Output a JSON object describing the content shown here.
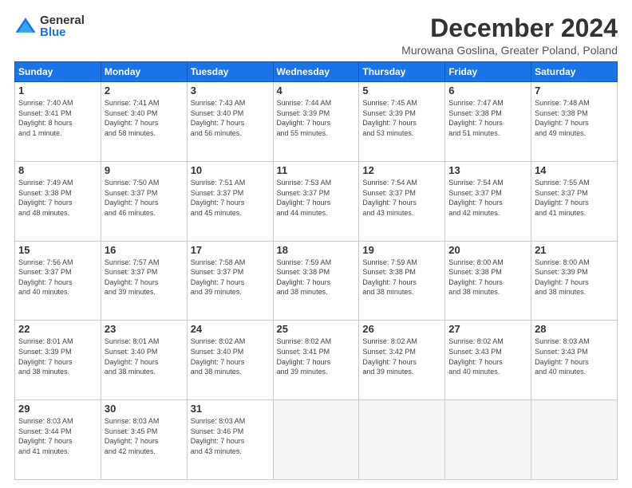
{
  "header": {
    "logo_general": "General",
    "logo_blue": "Blue",
    "month_title": "December 2024",
    "location": "Murowana Goslina, Greater Poland, Poland"
  },
  "days_of_week": [
    "Sunday",
    "Monday",
    "Tuesday",
    "Wednesday",
    "Thursday",
    "Friday",
    "Saturday"
  ],
  "weeks": [
    [
      {
        "day": "1",
        "info": "Sunrise: 7:40 AM\nSunset: 3:41 PM\nDaylight: 8 hours\nand 1 minute."
      },
      {
        "day": "2",
        "info": "Sunrise: 7:41 AM\nSunset: 3:40 PM\nDaylight: 7 hours\nand 58 minutes."
      },
      {
        "day": "3",
        "info": "Sunrise: 7:43 AM\nSunset: 3:40 PM\nDaylight: 7 hours\nand 56 minutes."
      },
      {
        "day": "4",
        "info": "Sunrise: 7:44 AM\nSunset: 3:39 PM\nDaylight: 7 hours\nand 55 minutes."
      },
      {
        "day": "5",
        "info": "Sunrise: 7:45 AM\nSunset: 3:39 PM\nDaylight: 7 hours\nand 53 minutes."
      },
      {
        "day": "6",
        "info": "Sunrise: 7:47 AM\nSunset: 3:38 PM\nDaylight: 7 hours\nand 51 minutes."
      },
      {
        "day": "7",
        "info": "Sunrise: 7:48 AM\nSunset: 3:38 PM\nDaylight: 7 hours\nand 49 minutes."
      }
    ],
    [
      {
        "day": "8",
        "info": "Sunrise: 7:49 AM\nSunset: 3:38 PM\nDaylight: 7 hours\nand 48 minutes."
      },
      {
        "day": "9",
        "info": "Sunrise: 7:50 AM\nSunset: 3:37 PM\nDaylight: 7 hours\nand 46 minutes."
      },
      {
        "day": "10",
        "info": "Sunrise: 7:51 AM\nSunset: 3:37 PM\nDaylight: 7 hours\nand 45 minutes."
      },
      {
        "day": "11",
        "info": "Sunrise: 7:53 AM\nSunset: 3:37 PM\nDaylight: 7 hours\nand 44 minutes."
      },
      {
        "day": "12",
        "info": "Sunrise: 7:54 AM\nSunset: 3:37 PM\nDaylight: 7 hours\nand 43 minutes."
      },
      {
        "day": "13",
        "info": "Sunrise: 7:54 AM\nSunset: 3:37 PM\nDaylight: 7 hours\nand 42 minutes."
      },
      {
        "day": "14",
        "info": "Sunrise: 7:55 AM\nSunset: 3:37 PM\nDaylight: 7 hours\nand 41 minutes."
      }
    ],
    [
      {
        "day": "15",
        "info": "Sunrise: 7:56 AM\nSunset: 3:37 PM\nDaylight: 7 hours\nand 40 minutes."
      },
      {
        "day": "16",
        "info": "Sunrise: 7:57 AM\nSunset: 3:37 PM\nDaylight: 7 hours\nand 39 minutes."
      },
      {
        "day": "17",
        "info": "Sunrise: 7:58 AM\nSunset: 3:37 PM\nDaylight: 7 hours\nand 39 minutes."
      },
      {
        "day": "18",
        "info": "Sunrise: 7:59 AM\nSunset: 3:38 PM\nDaylight: 7 hours\nand 38 minutes."
      },
      {
        "day": "19",
        "info": "Sunrise: 7:59 AM\nSunset: 3:38 PM\nDaylight: 7 hours\nand 38 minutes."
      },
      {
        "day": "20",
        "info": "Sunrise: 8:00 AM\nSunset: 3:38 PM\nDaylight: 7 hours\nand 38 minutes."
      },
      {
        "day": "21",
        "info": "Sunrise: 8:00 AM\nSunset: 3:39 PM\nDaylight: 7 hours\nand 38 minutes."
      }
    ],
    [
      {
        "day": "22",
        "info": "Sunrise: 8:01 AM\nSunset: 3:39 PM\nDaylight: 7 hours\nand 38 minutes."
      },
      {
        "day": "23",
        "info": "Sunrise: 8:01 AM\nSunset: 3:40 PM\nDaylight: 7 hours\nand 38 minutes."
      },
      {
        "day": "24",
        "info": "Sunrise: 8:02 AM\nSunset: 3:40 PM\nDaylight: 7 hours\nand 38 minutes."
      },
      {
        "day": "25",
        "info": "Sunrise: 8:02 AM\nSunset: 3:41 PM\nDaylight: 7 hours\nand 39 minutes."
      },
      {
        "day": "26",
        "info": "Sunrise: 8:02 AM\nSunset: 3:42 PM\nDaylight: 7 hours\nand 39 minutes."
      },
      {
        "day": "27",
        "info": "Sunrise: 8:02 AM\nSunset: 3:43 PM\nDaylight: 7 hours\nand 40 minutes."
      },
      {
        "day": "28",
        "info": "Sunrise: 8:03 AM\nSunset: 3:43 PM\nDaylight: 7 hours\nand 40 minutes."
      }
    ],
    [
      {
        "day": "29",
        "info": "Sunrise: 8:03 AM\nSunset: 3:44 PM\nDaylight: 7 hours\nand 41 minutes."
      },
      {
        "day": "30",
        "info": "Sunrise: 8:03 AM\nSunset: 3:45 PM\nDaylight: 7 hours\nand 42 minutes."
      },
      {
        "day": "31",
        "info": "Sunrise: 8:03 AM\nSunset: 3:46 PM\nDaylight: 7 hours\nand 43 minutes."
      },
      {
        "day": "",
        "info": ""
      },
      {
        "day": "",
        "info": ""
      },
      {
        "day": "",
        "info": ""
      },
      {
        "day": "",
        "info": ""
      }
    ]
  ]
}
